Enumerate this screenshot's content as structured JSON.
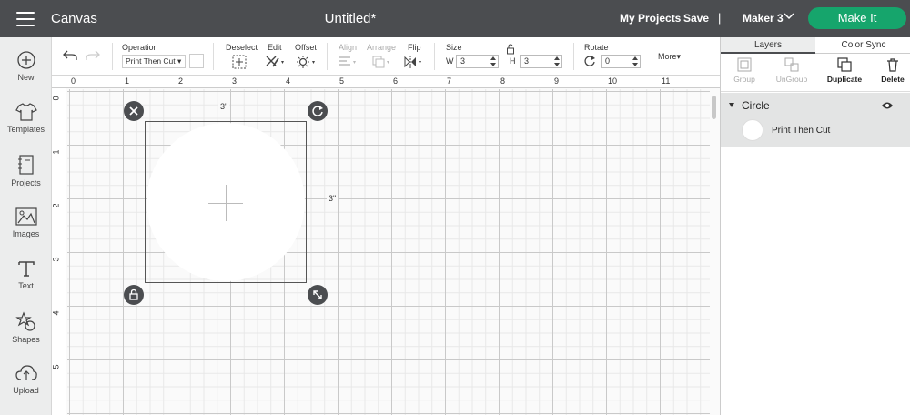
{
  "topbar": {
    "app_title": "Canvas",
    "doc_title": "Untitled*",
    "my_projects": "My Projects",
    "save": "Save",
    "separator": "|",
    "machine": "Maker 3",
    "make_it": "Make It",
    "make_it_color": "#16a56c",
    "bar_color": "#4b4d50"
  },
  "sidebar": {
    "items": [
      {
        "label": "New",
        "icon": "plus-circle-icon"
      },
      {
        "label": "Templates",
        "icon": "tshirt-icon"
      },
      {
        "label": "Projects",
        "icon": "notebook-icon"
      },
      {
        "label": "Images",
        "icon": "image-icon"
      },
      {
        "label": "Text",
        "icon": "text-icon"
      },
      {
        "label": "Shapes",
        "icon": "shapes-icon"
      },
      {
        "label": "Upload",
        "icon": "upload-icon"
      }
    ]
  },
  "toolbar": {
    "operation_label": "Operation",
    "operation_value": "Print Then Cut",
    "deselect_label": "Deselect",
    "edit_label": "Edit",
    "offset_label": "Offset",
    "align_label": "Align",
    "arrange_label": "Arrange",
    "flip_label": "Flip",
    "size_label": "Size",
    "w_label": "W",
    "w_value": "3",
    "h_label": "H",
    "h_value": "3",
    "rotate_label": "Rotate",
    "rotate_value": "0",
    "more_label": "More"
  },
  "canvas": {
    "ruler_x": [
      "0",
      "1",
      "2",
      "3",
      "4",
      "5",
      "6",
      "7",
      "8",
      "9",
      "10",
      "11"
    ],
    "ruler_y": [
      "0",
      "1",
      "2",
      "3",
      "4",
      "5"
    ],
    "width_label": "3\"",
    "height_label": "3\""
  },
  "panel": {
    "tab_layers": "Layers",
    "tab_color_sync": "Color Sync",
    "group": "Group",
    "ungroup": "UnGroup",
    "duplicate": "Duplicate",
    "delete": "Delete",
    "layer_name": "Circle",
    "layer_item_label": "Print Then Cut"
  }
}
